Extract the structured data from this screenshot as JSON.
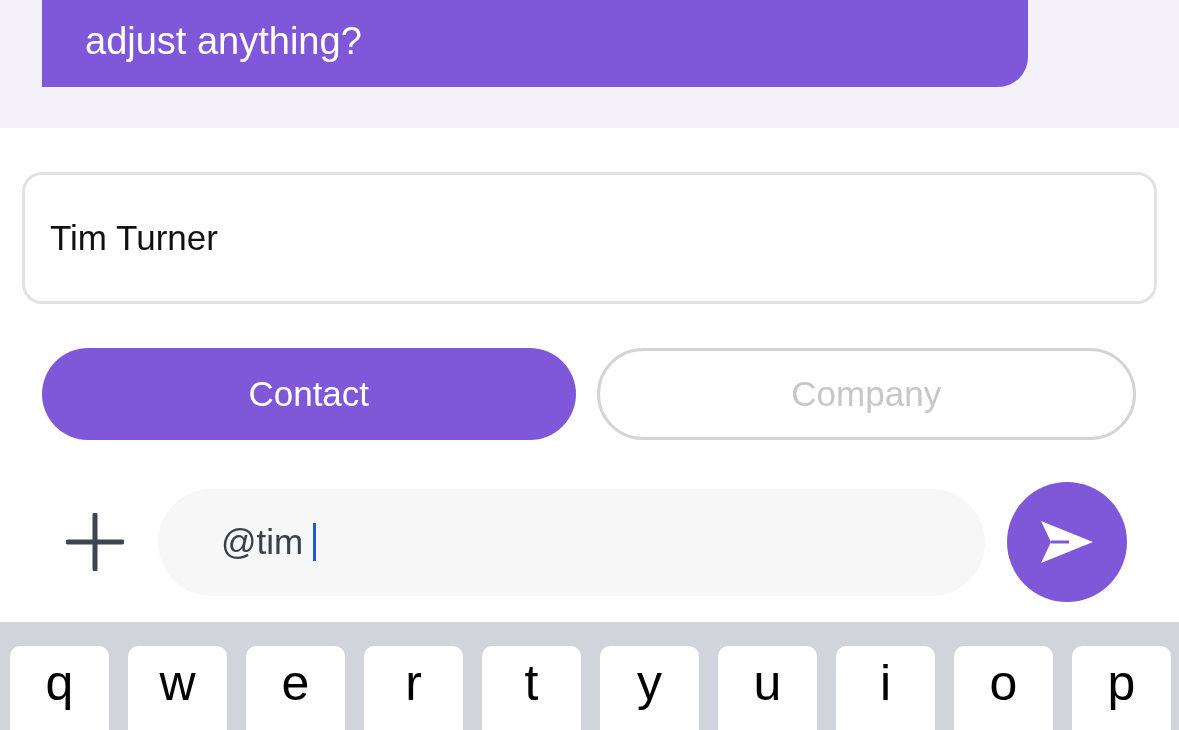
{
  "message": {
    "text": "adjust anything?"
  },
  "name_field": {
    "value": "Tim Turner"
  },
  "type_toggle": [
    {
      "label": "Contact",
      "selected": true
    },
    {
      "label": "Company",
      "selected": false
    }
  ],
  "composer": {
    "value": "@tim"
  },
  "keyboard": {
    "keys": [
      "q",
      "w",
      "e",
      "r",
      "t",
      "y",
      "u",
      "i",
      "o",
      "p"
    ]
  }
}
